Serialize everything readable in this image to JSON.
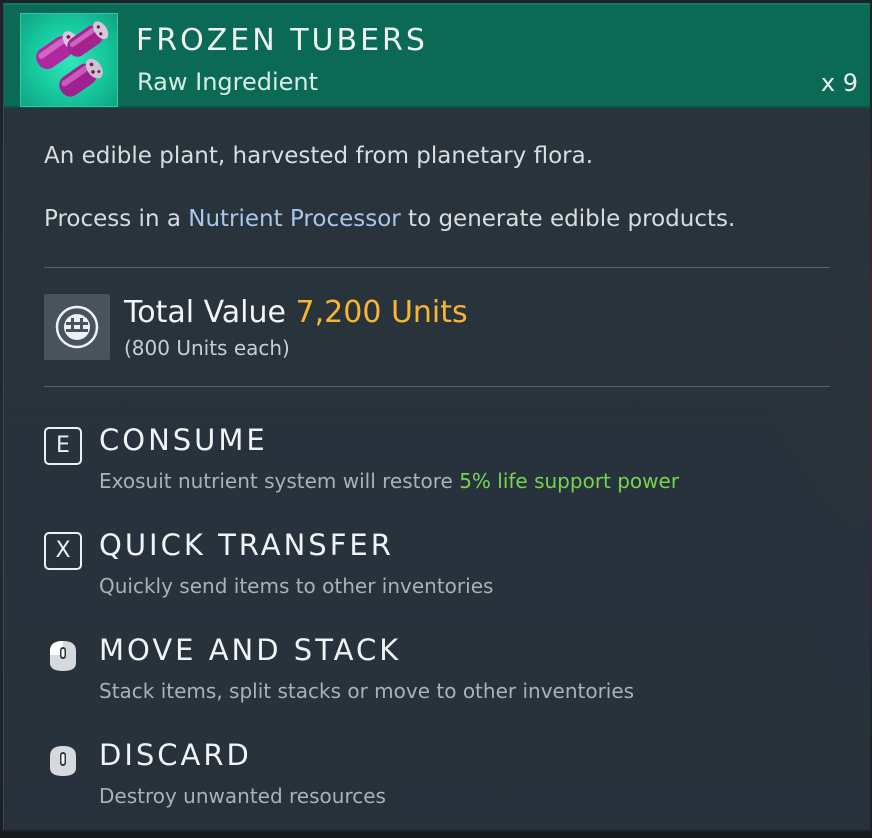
{
  "item": {
    "title": "FROZEN TUBERS",
    "subtitle": "Raw Ingredient",
    "quantity": "x 9",
    "icon": "frozen-tubers-icon"
  },
  "description": {
    "line1": "An edible plant, harvested from planetary flora.",
    "line2_prefix": "Process in a ",
    "line2_link": "Nutrient Processor",
    "line2_suffix": " to generate edible products."
  },
  "value": {
    "label": "Total Value ",
    "amount": "7,200 Units",
    "each": "(800 Units each)",
    "icon": "units-currency-icon"
  },
  "actions": [
    {
      "key": "E",
      "key_type": "keyboard",
      "title": "CONSUME",
      "desc_prefix": "Exosuit nutrient system will restore ",
      "desc_highlight": "5% life support power"
    },
    {
      "key": "X",
      "key_type": "keyboard",
      "title": "QUICK TRANSFER",
      "desc": "Quickly send items to other inventories"
    },
    {
      "key_type": "mouse-left",
      "title": "MOVE AND STACK",
      "desc": "Stack items, split stacks or move to other inventories"
    },
    {
      "key_type": "mouse-hold",
      "title": "DISCARD",
      "desc": "Destroy unwanted resources"
    }
  ],
  "colors": {
    "header": "#0b6a55",
    "icon_bg": "#17c89d",
    "value_amount": "#f6b632",
    "link": "#a9c7ea",
    "positive": "#78d34f"
  }
}
